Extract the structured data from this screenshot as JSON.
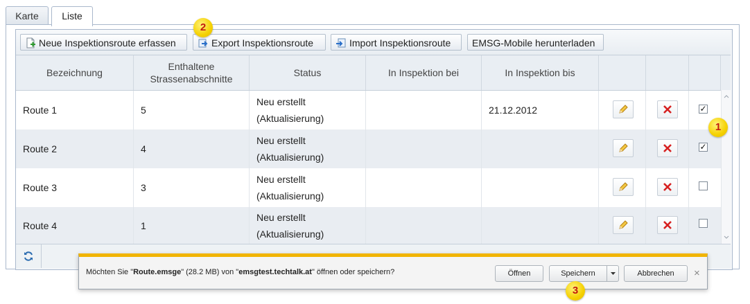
{
  "tabs": [
    "Karte",
    "Liste"
  ],
  "toolbar": {
    "new_label": "Neue Inspektionsroute erfassen",
    "export_label": "Export Inspektionsroute",
    "import_label": "Import Inspektionsroute",
    "mobile_label": "EMSG-Mobile herunterladen"
  },
  "table": {
    "headers": [
      "Bezeichnung",
      "Enthaltene Strassenabschnitte",
      "Status",
      "In Inspektion bei",
      "In Inspektion bis"
    ],
    "rows": [
      {
        "name": "Route 1",
        "count": "5",
        "status1": "Neu erstellt",
        "status2": "(Aktualisierung)",
        "bei": "",
        "bis": "21.12.2012",
        "checked": true
      },
      {
        "name": "Route 2",
        "count": "4",
        "status1": "Neu erstellt",
        "status2": "(Aktualisierung)",
        "bei": "",
        "bis": "",
        "checked": true
      },
      {
        "name": "Route 3",
        "count": "3",
        "status1": "Neu erstellt",
        "status2": "(Aktualisierung)",
        "bei": "",
        "bis": "",
        "checked": false
      },
      {
        "name": "Route 4",
        "count": "1",
        "status1": "Neu erstellt",
        "status2": "(Aktualisierung)",
        "bei": "",
        "bis": "",
        "checked": false
      }
    ]
  },
  "download": {
    "prefix": "Möchten Sie \"",
    "filename": "Route.emsge",
    "middle": "\" (28.2 MB) von \"",
    "host": "emsgtest.techtalk.at",
    "suffix": "\" öffnen oder speichern?",
    "open_label": "Öffnen",
    "save_label": "Speichern",
    "cancel_label": "Abbrechen",
    "close_glyph": "×"
  },
  "badges": [
    "1",
    "2",
    "3"
  ],
  "icons": {
    "new": "add-document-icon",
    "export": "export-icon",
    "import": "import-icon",
    "edit": "pencil-icon",
    "delete": "delete-x-icon",
    "refresh": "refresh-icon"
  },
  "colors": {
    "accent_bar": "#f1b400",
    "badge": "#f5d100",
    "badge_text": "#c2190f",
    "delete": "#d62020"
  }
}
